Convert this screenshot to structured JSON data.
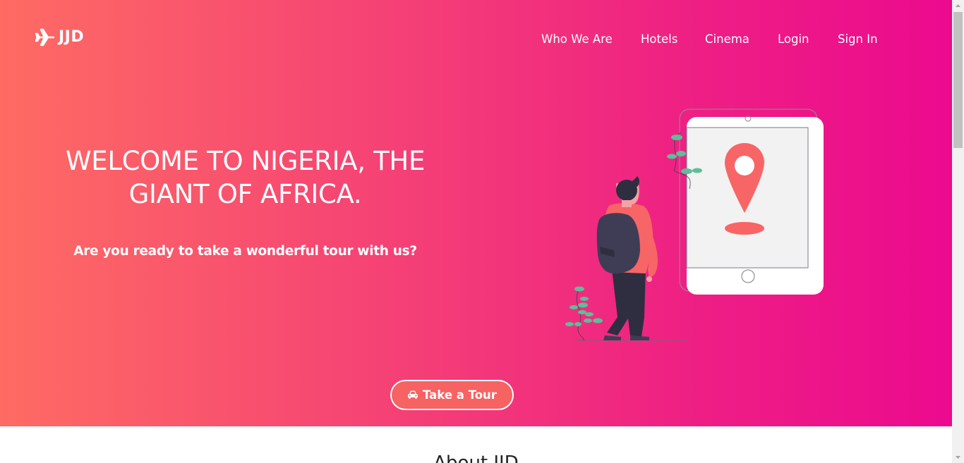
{
  "brand": {
    "name": "JJD",
    "icon": "plane-icon"
  },
  "nav": {
    "items": [
      {
        "label": "Who We Are"
      },
      {
        "label": "Hotels"
      },
      {
        "label": "Cinema"
      },
      {
        "label": "Login"
      },
      {
        "label": "Sign In"
      }
    ]
  },
  "hero": {
    "headline_line1": "WELCOME TO NIGERIA, THE",
    "headline_line2": "GIANT OF AFRICA.",
    "subline": "Are you ready to take a wonderful tour with us?",
    "cta_label": "Take a Tour",
    "cta_icon": "car-icon",
    "illustration": "traveler-with-tablet-map-pin-illustration"
  },
  "about": {
    "title": "About JJD"
  },
  "colors": {
    "gradient_start": "#fe6b63",
    "gradient_mid": "#f43d77",
    "gradient_end": "#ec0a8e",
    "button_bg": "#f76262",
    "pin": "#f86566",
    "leaf": "#5bbf98",
    "backpack": "#3f3d56"
  }
}
